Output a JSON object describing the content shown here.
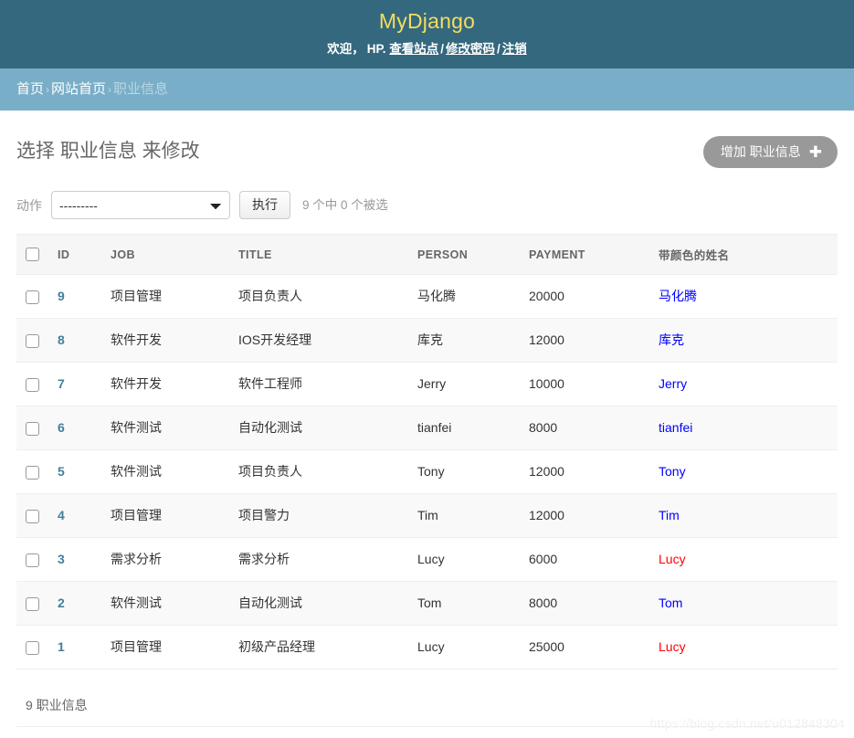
{
  "header": {
    "site_title": "MyDjango",
    "welcome_text": "欢迎，",
    "username": "HP.",
    "links": [
      {
        "label": "查看站点"
      },
      {
        "label": "修改密码"
      },
      {
        "label": "注销"
      }
    ],
    "separator": "/"
  },
  "breadcrumbs": {
    "items": [
      {
        "label": "首页",
        "current": false
      },
      {
        "label": "网站首页",
        "current": false
      },
      {
        "label": "职业信息",
        "current": true
      }
    ],
    "separator": "›"
  },
  "main": {
    "page_title": "选择 职业信息 来修改",
    "add_button": {
      "label": "增加 职业信息",
      "icon": "plus-icon",
      "glyph": "✚"
    }
  },
  "actions": {
    "label": "动作",
    "selected_option": "---------",
    "options": [
      "---------"
    ],
    "run_button": "执行",
    "counter": "9 个中 0 个被选"
  },
  "table": {
    "columns": [
      {
        "key": "check",
        "label": ""
      },
      {
        "key": "id",
        "label": "ID"
      },
      {
        "key": "job",
        "label": "JOB"
      },
      {
        "key": "title",
        "label": "TITLE"
      },
      {
        "key": "person",
        "label": "PERSON"
      },
      {
        "key": "payment",
        "label": "PAYMENT"
      },
      {
        "key": "colored",
        "label": "带颜色的姓名"
      }
    ],
    "rows": [
      {
        "id": "9",
        "job": "项目管理",
        "title": "项目负责人",
        "person": "马化腾",
        "payment": "20000",
        "colored": "马化腾",
        "colored_color": "#0000ff"
      },
      {
        "id": "8",
        "job": "软件开发",
        "title": "IOS开发经理",
        "person": "库克",
        "payment": "12000",
        "colored": "库克",
        "colored_color": "#0000ff"
      },
      {
        "id": "7",
        "job": "软件开发",
        "title": "软件工程师",
        "person": "Jerry",
        "payment": "10000",
        "colored": "Jerry",
        "colored_color": "#0000ff"
      },
      {
        "id": "6",
        "job": "软件测试",
        "title": "自动化测试",
        "person": "tianfei",
        "payment": "8000",
        "colored": "tianfei",
        "colored_color": "#0000ff"
      },
      {
        "id": "5",
        "job": "软件测试",
        "title": "项目负责人",
        "person": "Tony",
        "payment": "12000",
        "colored": "Tony",
        "colored_color": "#0000ff"
      },
      {
        "id": "4",
        "job": "项目管理",
        "title": "项目警力",
        "person": "Tim",
        "payment": "12000",
        "colored": "Tim",
        "colored_color": "#0000ff"
      },
      {
        "id": "3",
        "job": "需求分析",
        "title": "需求分析",
        "person": "Lucy",
        "payment": "6000",
        "colored": "Lucy",
        "colored_color": "#ff0000"
      },
      {
        "id": "2",
        "job": "软件测试",
        "title": "自动化测试",
        "person": "Tom",
        "payment": "8000",
        "colored": "Tom",
        "colored_color": "#0000ff"
      },
      {
        "id": "1",
        "job": "项目管理",
        "title": "初级产品经理",
        "person": "Lucy",
        "payment": "25000",
        "colored": "Lucy",
        "colored_color": "#ff0000"
      }
    ]
  },
  "footer": {
    "count_text": "9 职业信息"
  },
  "watermark": {
    "text": "https://blog.csdn.net/u012848304"
  },
  "colors": {
    "header_bg": "#34687e",
    "breadcrumb_bg": "#79aec8",
    "brand": "#f5dd5d",
    "link": "#447e9b",
    "button_gray": "#999999"
  }
}
